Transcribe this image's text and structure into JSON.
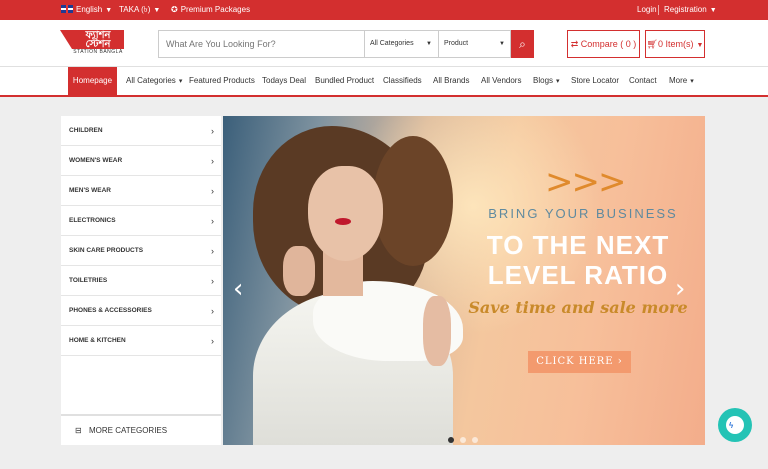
{
  "topbar": {
    "language": "English",
    "currency": "TAKA (৳)",
    "premium": "Premium Packages",
    "login": "Login",
    "registration": "Registration"
  },
  "logo": {
    "line1": "ফ্যাশন",
    "line2": "স্টেশন",
    "sub": "STATION BANGLA"
  },
  "search": {
    "placeholder": "What Are You Looking For?",
    "category_select": "All Categories",
    "type_select": "Product"
  },
  "header": {
    "compare": "Compare ( 0 )",
    "cart": "0 Item(s)"
  },
  "nav": {
    "items": [
      "Homepage",
      "All Categories",
      "Featured Products",
      "Todays Deal",
      "Bundled Product",
      "Classifieds",
      "All Brands",
      "All Vendors",
      "Blogs",
      "Store Locator",
      "Contact",
      "More"
    ]
  },
  "categories": {
    "items": [
      "Children",
      "Women's Wear",
      "Men's Wear",
      "Electronics",
      "Skin Care Products",
      "Toiletries",
      "Phones & Accessories",
      "Home & Kitchen"
    ],
    "more": "MORE CATEGORIES"
  },
  "banner": {
    "line1": "BRING YOUR BUSINESS",
    "line2": "TO THE NEXT",
    "line3": "LEVEL RATIO",
    "tagline": "Save time and sale more",
    "cta": "CLICK HERE",
    "slide_count": 3,
    "active_slide": 1
  },
  "colors": {
    "brand": "#d32f2f",
    "messenger": "#24c3b5",
    "accent": "#f39a6e"
  },
  "icons": [
    "uk-flag-icon",
    "tag-icon",
    "search-icon",
    "compare-icon",
    "cart-icon",
    "chevron-right-icon",
    "minus-square-icon",
    "messenger-icon"
  ]
}
